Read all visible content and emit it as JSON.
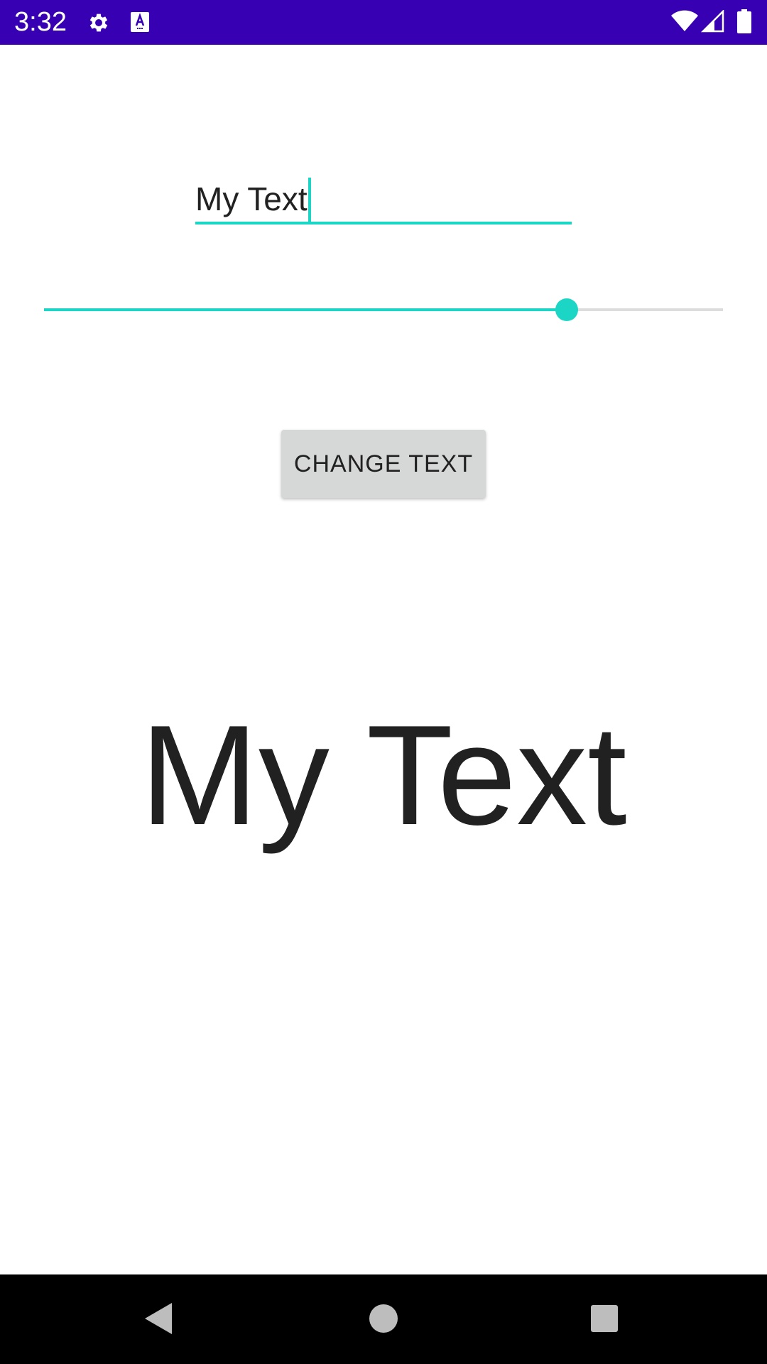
{
  "status_bar": {
    "time": "3:32",
    "icons": [
      "gear-icon",
      "text-a-icon",
      "wifi-icon",
      "signal-icon",
      "battery-icon"
    ],
    "background": "#3700b3"
  },
  "input": {
    "value": "My Text",
    "underline_color": "#1cd6c5"
  },
  "slider": {
    "value_fraction": 0.77,
    "accent_color": "#1cd6c5"
  },
  "button": {
    "label": "CHANGE TEXT"
  },
  "display": {
    "text": "My Text"
  },
  "nav_bar": {
    "icons": [
      "back-icon",
      "home-icon",
      "recents-icon"
    ]
  }
}
